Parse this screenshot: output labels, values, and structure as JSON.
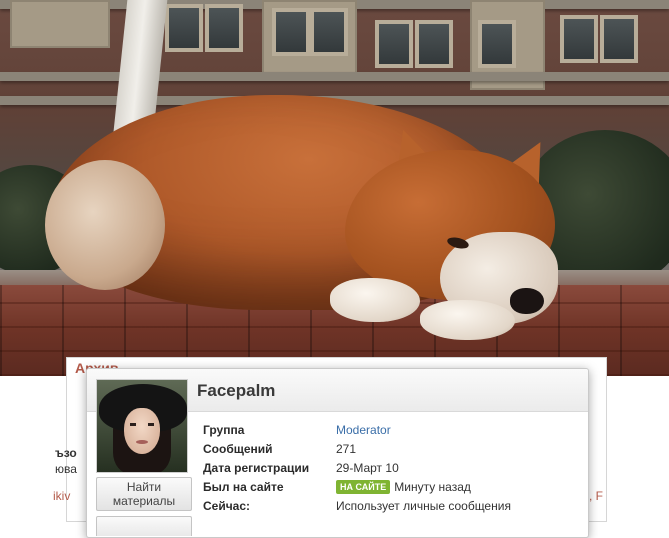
{
  "panel": {
    "header": "Архив",
    "fragments": [
      "ъзо",
      "юва",
      "ikiv",
      ", F"
    ]
  },
  "profile": {
    "username": "Facepalm",
    "find_button_line1": "Найти",
    "find_button_line2": "материалы",
    "rows": [
      {
        "label": "Группа",
        "value": "Moderator"
      },
      {
        "label": "Сообщений",
        "value": "271"
      },
      {
        "label": "Дата регистрации",
        "value": "29-Март 10"
      },
      {
        "label": "Был на сайте",
        "badge": "НА САЙТЕ",
        "value": "Минуту назад"
      },
      {
        "label": "Сейчас:",
        "value": "Использует личные сообщения"
      }
    ]
  },
  "colors": {
    "link": "#3a6ea8",
    "online_badge": "#7fb432",
    "panel_header": "#b35a4a"
  }
}
